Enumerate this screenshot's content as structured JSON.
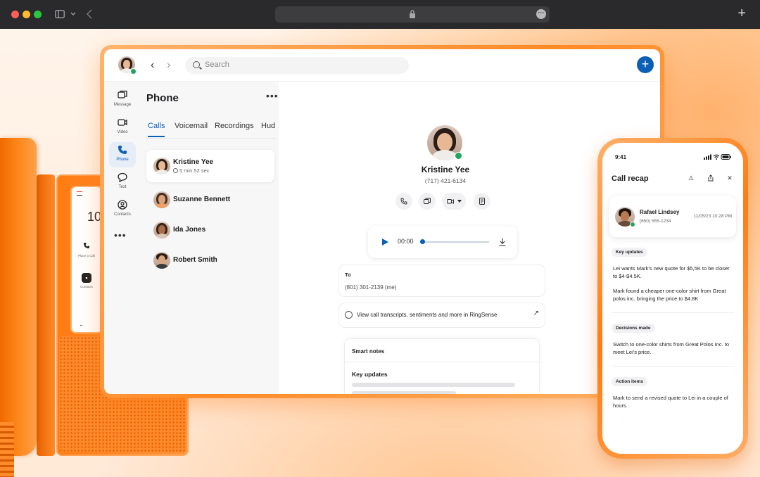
{
  "colors": {
    "accent": "#0b5fb5",
    "online": "#21a45b",
    "brand_orange": "#ff7d12"
  },
  "desk_phone": {
    "screen_number": "10",
    "items": [
      {
        "icon": "phone-icon",
        "label": "Place a Call"
      },
      {
        "icon": "contacts-icon",
        "label": "Contacts"
      }
    ]
  },
  "app": {
    "search_placeholder": "Search",
    "rail": [
      {
        "icon": "message-icon",
        "label": "Message"
      },
      {
        "icon": "video-icon",
        "label": "Video"
      },
      {
        "icon": "phone-icon",
        "label": "Phone",
        "active": true
      },
      {
        "icon": "text-icon",
        "label": "Text"
      },
      {
        "icon": "contacts-icon",
        "label": "Contacts"
      }
    ],
    "pane_title": "Phone",
    "tabs": [
      "Calls",
      "Voicemail",
      "Recordings",
      "Hud"
    ],
    "calls": [
      {
        "name": "Kristine Yee",
        "duration": "5 min 52 sec"
      },
      {
        "name": "Suzanne Bennett"
      },
      {
        "name": "Ida Jones"
      },
      {
        "name": "Robert Smith"
      }
    ],
    "detail": {
      "name": "Kristine Yee",
      "phone": "(717) 421-6134",
      "player_time": "00:00",
      "player_progress": 0,
      "to_label": "To",
      "to_value": "(801) 301-2139 (me)",
      "ringsense_text": "View call transcripts, sentiments and more in RingSense",
      "smart_notes_title": "Smart notes",
      "key_updates_title": "Key updates"
    }
  },
  "mobile": {
    "time": "9:41",
    "title": "Call recap",
    "contact": {
      "name": "Rafael Lindsey",
      "phone": "(650) 555-1234",
      "datetime": "11/05/23 10:28 PM"
    },
    "sections": {
      "key_updates": {
        "label": "Key updates",
        "items": [
          "Lei wants Mark's new quote for $5,5K to be closer to $4-$4.5K.",
          "Mark found a cheaper one-color shirt from Great polos inc. bringing the price to $4.8K"
        ]
      },
      "decisions": {
        "label": "Decisions made",
        "items": [
          "Switch to one-color shirts from Great Polos Inc. to meet Lei's price."
        ]
      },
      "actions": {
        "label": "Action items",
        "items": [
          "Mark to send a revised quote to Lei in a couple of hours."
        ]
      }
    }
  }
}
